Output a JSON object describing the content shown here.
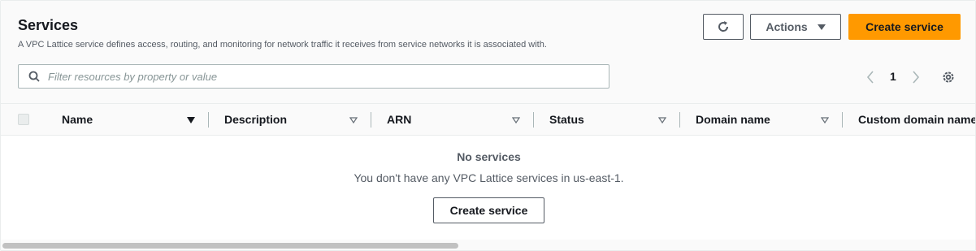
{
  "header": {
    "title": "Services",
    "description": "A VPC Lattice service defines access, routing, and monitoring for network traffic it receives from service networks it is associated with.",
    "actions_label": "Actions",
    "create_label": "Create service",
    "refresh_icon": "refresh-icon"
  },
  "search": {
    "placeholder": "Filter resources by property or value",
    "value": ""
  },
  "pagination": {
    "current_page": "1"
  },
  "table": {
    "columns": [
      {
        "label": "Name",
        "sort": "descending"
      },
      {
        "label": "Description",
        "sort": "none"
      },
      {
        "label": "ARN",
        "sort": "none"
      },
      {
        "label": "Status",
        "sort": "none"
      },
      {
        "label": "Domain name",
        "sort": "none"
      },
      {
        "label": "Custom domain name",
        "sort": "none"
      }
    ],
    "empty": {
      "title": "No services",
      "message": "You don't have any VPC Lattice services in us-east-1.",
      "button_label": "Create service"
    }
  },
  "colors": {
    "primary": "#ff9900",
    "text": "#16191f",
    "secondary_text": "#545b64",
    "border": "#aab7b8"
  }
}
